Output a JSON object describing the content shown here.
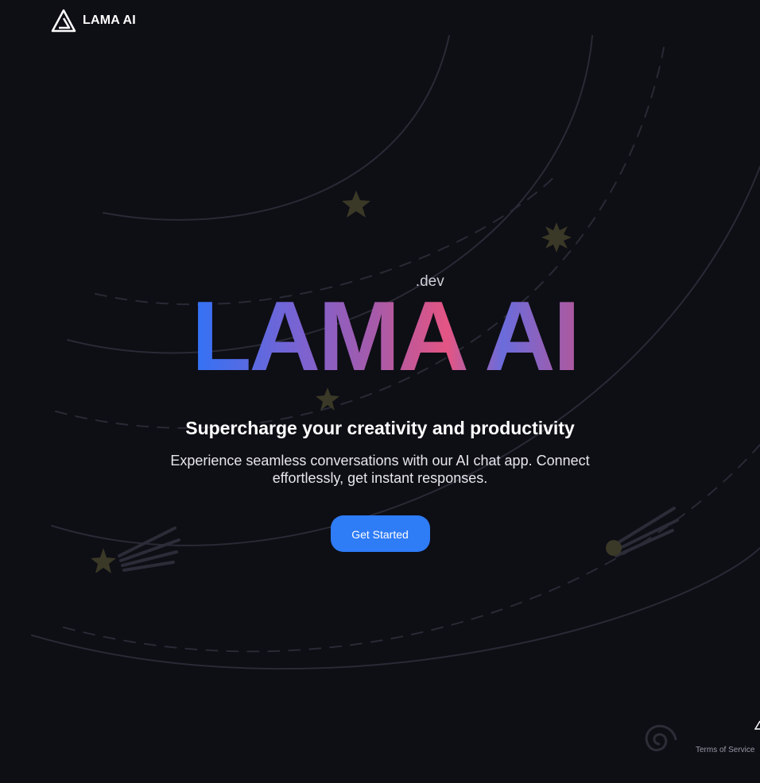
{
  "header": {
    "logo_text": "LAMA AI"
  },
  "hero": {
    "brand_suffix": ".dev",
    "brand_title": "LAMA AI",
    "tagline": "Supercharge your creativity and productivity",
    "description": "Experience seamless conversations with our AI chat app. Connect effortlessly, get instant responses.",
    "cta_label": "Get Started"
  },
  "footer": {
    "terms_label": "Terms of Service"
  },
  "colors": {
    "background": "#0e0e15",
    "accent": "#2e7cf6",
    "gradient_start": "#2f73f7",
    "gradient_mid": "#e45583",
    "gradient_end": "#b3579b"
  },
  "icons": {
    "logo": "lama-triangle-logo-icon",
    "decor": [
      "star-icon",
      "sparkle-icon",
      "comet-icon",
      "spiral-icon"
    ]
  }
}
